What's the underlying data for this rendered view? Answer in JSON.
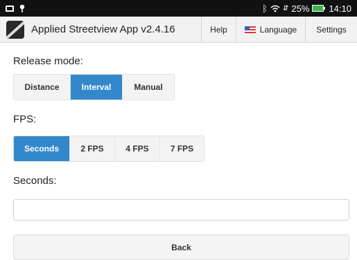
{
  "status_bar": {
    "battery": "25%",
    "time": "14:10",
    "icons": [
      "screen-icon",
      "location-pin-icon",
      "bluetooth-icon",
      "wifi-icon",
      "battery-icon"
    ]
  },
  "app_bar": {
    "title": "Applied Streetview App v2.4.16",
    "help": "Help",
    "language": "Language",
    "settings": "Settings"
  },
  "release_mode": {
    "label": "Release mode:",
    "options": [
      "Distance",
      "Interval",
      "Manual"
    ],
    "selected": "Interval"
  },
  "fps": {
    "label": "FPS:",
    "options": [
      "Seconds",
      "2 FPS",
      "4 FPS",
      "7 FPS"
    ],
    "selected": "Seconds"
  },
  "seconds": {
    "label": "Seconds:",
    "value": ""
  },
  "back": "Back",
  "colors": {
    "accent": "#3388cc",
    "battery": "#3bb54a"
  }
}
